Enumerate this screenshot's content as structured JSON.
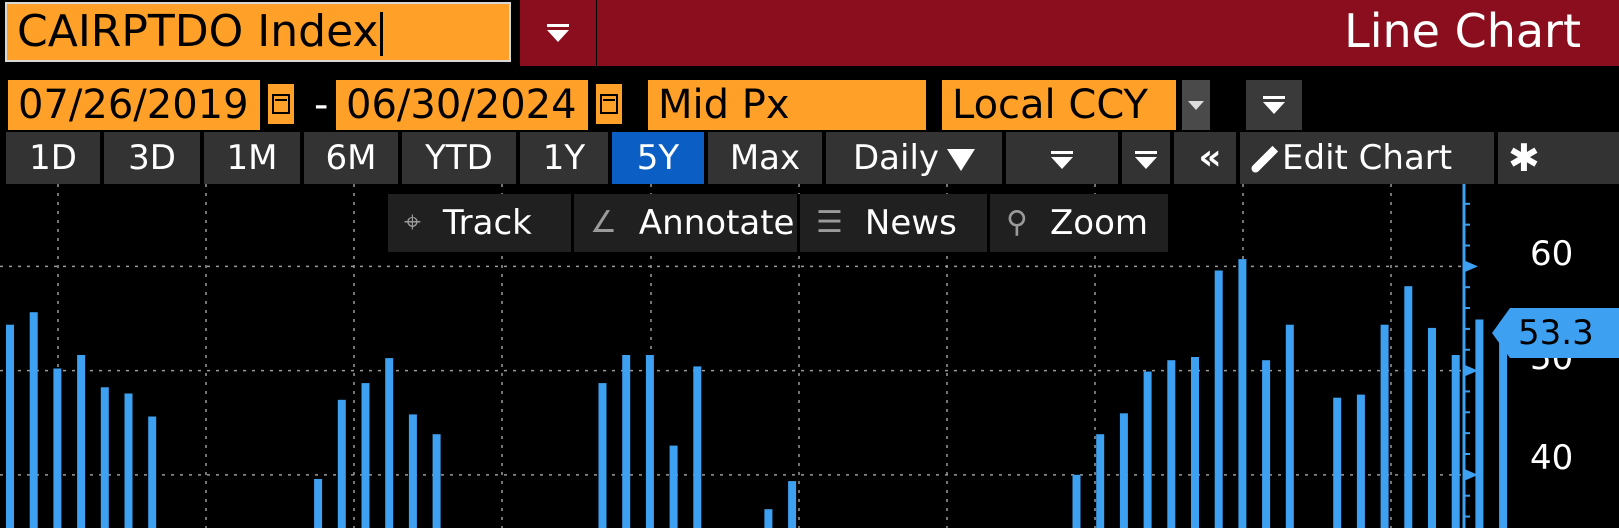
{
  "header": {
    "security": "CAIRPTDO Index",
    "function_title": "Line Chart"
  },
  "range": {
    "start_date": "07/26/2019",
    "separator": "-",
    "end_date": "06/30/2024",
    "field": "Mid Px",
    "currency": "Local CCY"
  },
  "toolbar": {
    "periods": [
      "1D",
      "3D",
      "1M",
      "6M",
      "YTD",
      "1Y",
      "5Y",
      "Max"
    ],
    "active_period": "5Y",
    "frequency": "Daily",
    "edit_chart": "Edit Chart"
  },
  "chart_tools": {
    "track": "Track",
    "annotate": "Annotate",
    "news": "News",
    "zoom": "Zoom"
  },
  "icons": [
    "calendar-icon",
    "filter-icon",
    "dropdown-icon",
    "rewind-icon",
    "pencil-icon",
    "gear-icon",
    "crosshair-icon",
    "annotate-icon",
    "news-icon",
    "magnifier-icon"
  ],
  "colors": {
    "title_bar": "#8a0e1d",
    "input_fill": "#ffa028",
    "active_tab": "#0b5fc4",
    "series": "#3ea0f0",
    "background": "#000000"
  },
  "chart_data": {
    "type": "bar",
    "y_ticks": [
      "60",
      "50",
      "40"
    ],
    "last_value": "53.3",
    "ylim": [
      34.9,
      67.9
    ],
    "grid": true,
    "series": [
      {
        "values": [
          54.4,
          55.6,
          50.2,
          51.5,
          48.4,
          47.8,
          45.6,
          null,
          null,
          null,
          null,
          null,
          null,
          39.6,
          47.2,
          48.8,
          51.2,
          45.8,
          43.9,
          null,
          null,
          null,
          null,
          null,
          null,
          48.8,
          51.5,
          51.5,
          42.8,
          50.4,
          null,
          null,
          36.7,
          39.4,
          null,
          null,
          null,
          null,
          null,
          null,
          null,
          null,
          null,
          null,
          null,
          40.0,
          43.9,
          45.9,
          49.9,
          51.0,
          51.3,
          59.6,
          60.7,
          51.0,
          54.4,
          null,
          47.4,
          47.7,
          54.4,
          58.1,
          54.1,
          51.5,
          54.9,
          54.6
        ]
      }
    ]
  }
}
